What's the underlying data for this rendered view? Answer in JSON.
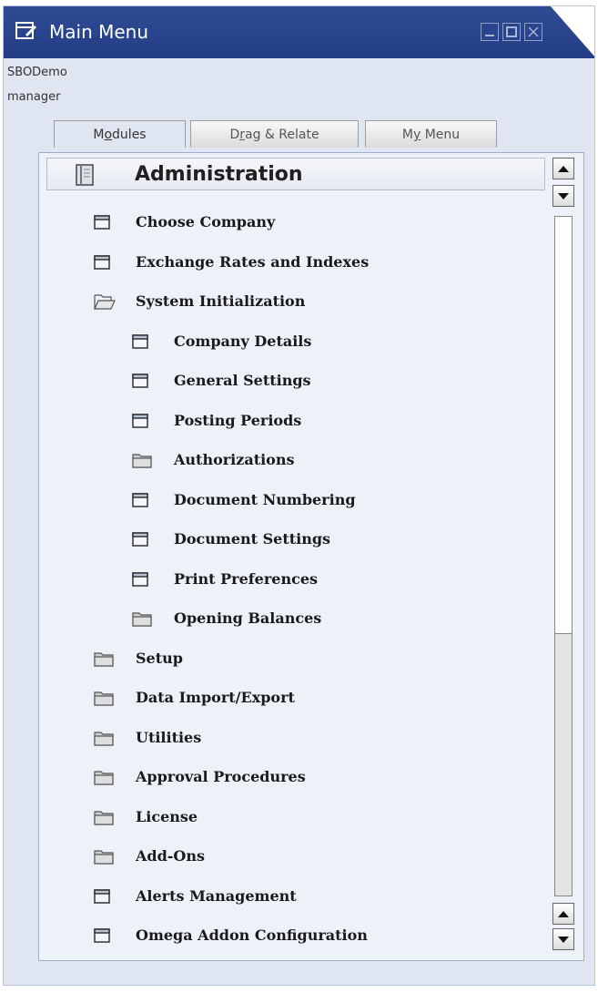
{
  "window": {
    "title": "Main Menu"
  },
  "user": {
    "company": "SBODemo",
    "username": "manager"
  },
  "tabs": [
    {
      "pre": "M",
      "key": "o",
      "post": "dules",
      "active": true
    },
    {
      "pre": "D",
      "key": "r",
      "post": "ag & Relate",
      "active": false
    },
    {
      "pre": "M",
      "key": "y",
      "post": " Menu",
      "active": false
    }
  ],
  "module": {
    "title": "Administration"
  },
  "items": [
    {
      "label": "Choose Company",
      "icon": "form-icon",
      "level": 1
    },
    {
      "label": "Exchange Rates and Indexes",
      "icon": "form-icon",
      "level": 1
    },
    {
      "label": "System Initialization",
      "icon": "folder-open-icon",
      "level": 1
    },
    {
      "label": "Company Details",
      "icon": "form-icon",
      "level": 2
    },
    {
      "label": "General Settings",
      "icon": "form-icon",
      "level": 2
    },
    {
      "label": "Posting Periods",
      "icon": "form-icon",
      "level": 2
    },
    {
      "label": "Authorizations",
      "icon": "folder-icon",
      "level": 2
    },
    {
      "label": "Document Numbering",
      "icon": "form-icon",
      "level": 2
    },
    {
      "label": "Document Settings",
      "icon": "form-icon",
      "level": 2
    },
    {
      "label": "Print Preferences",
      "icon": "form-icon",
      "level": 2
    },
    {
      "label": "Opening Balances",
      "icon": "folder-icon",
      "level": 2
    },
    {
      "label": "Setup",
      "icon": "folder-icon",
      "level": 1
    },
    {
      "label": "Data Import/Export",
      "icon": "folder-icon",
      "level": 1
    },
    {
      "label": "Utilities",
      "icon": "folder-icon",
      "level": 1
    },
    {
      "label": "Approval Procedures",
      "icon": "folder-icon",
      "level": 1
    },
    {
      "label": "License",
      "icon": "folder-icon",
      "level": 1
    },
    {
      "label": "Add-Ons",
      "icon": "folder-icon",
      "level": 1
    },
    {
      "label": "Alerts Management",
      "icon": "form-icon",
      "level": 1
    },
    {
      "label": "Omega Addon Configuration",
      "icon": "form-icon",
      "level": 1
    }
  ],
  "colors": {
    "titlebar": "#2a4790",
    "panel": "#edf1f8",
    "window": "#dfe6f1"
  }
}
